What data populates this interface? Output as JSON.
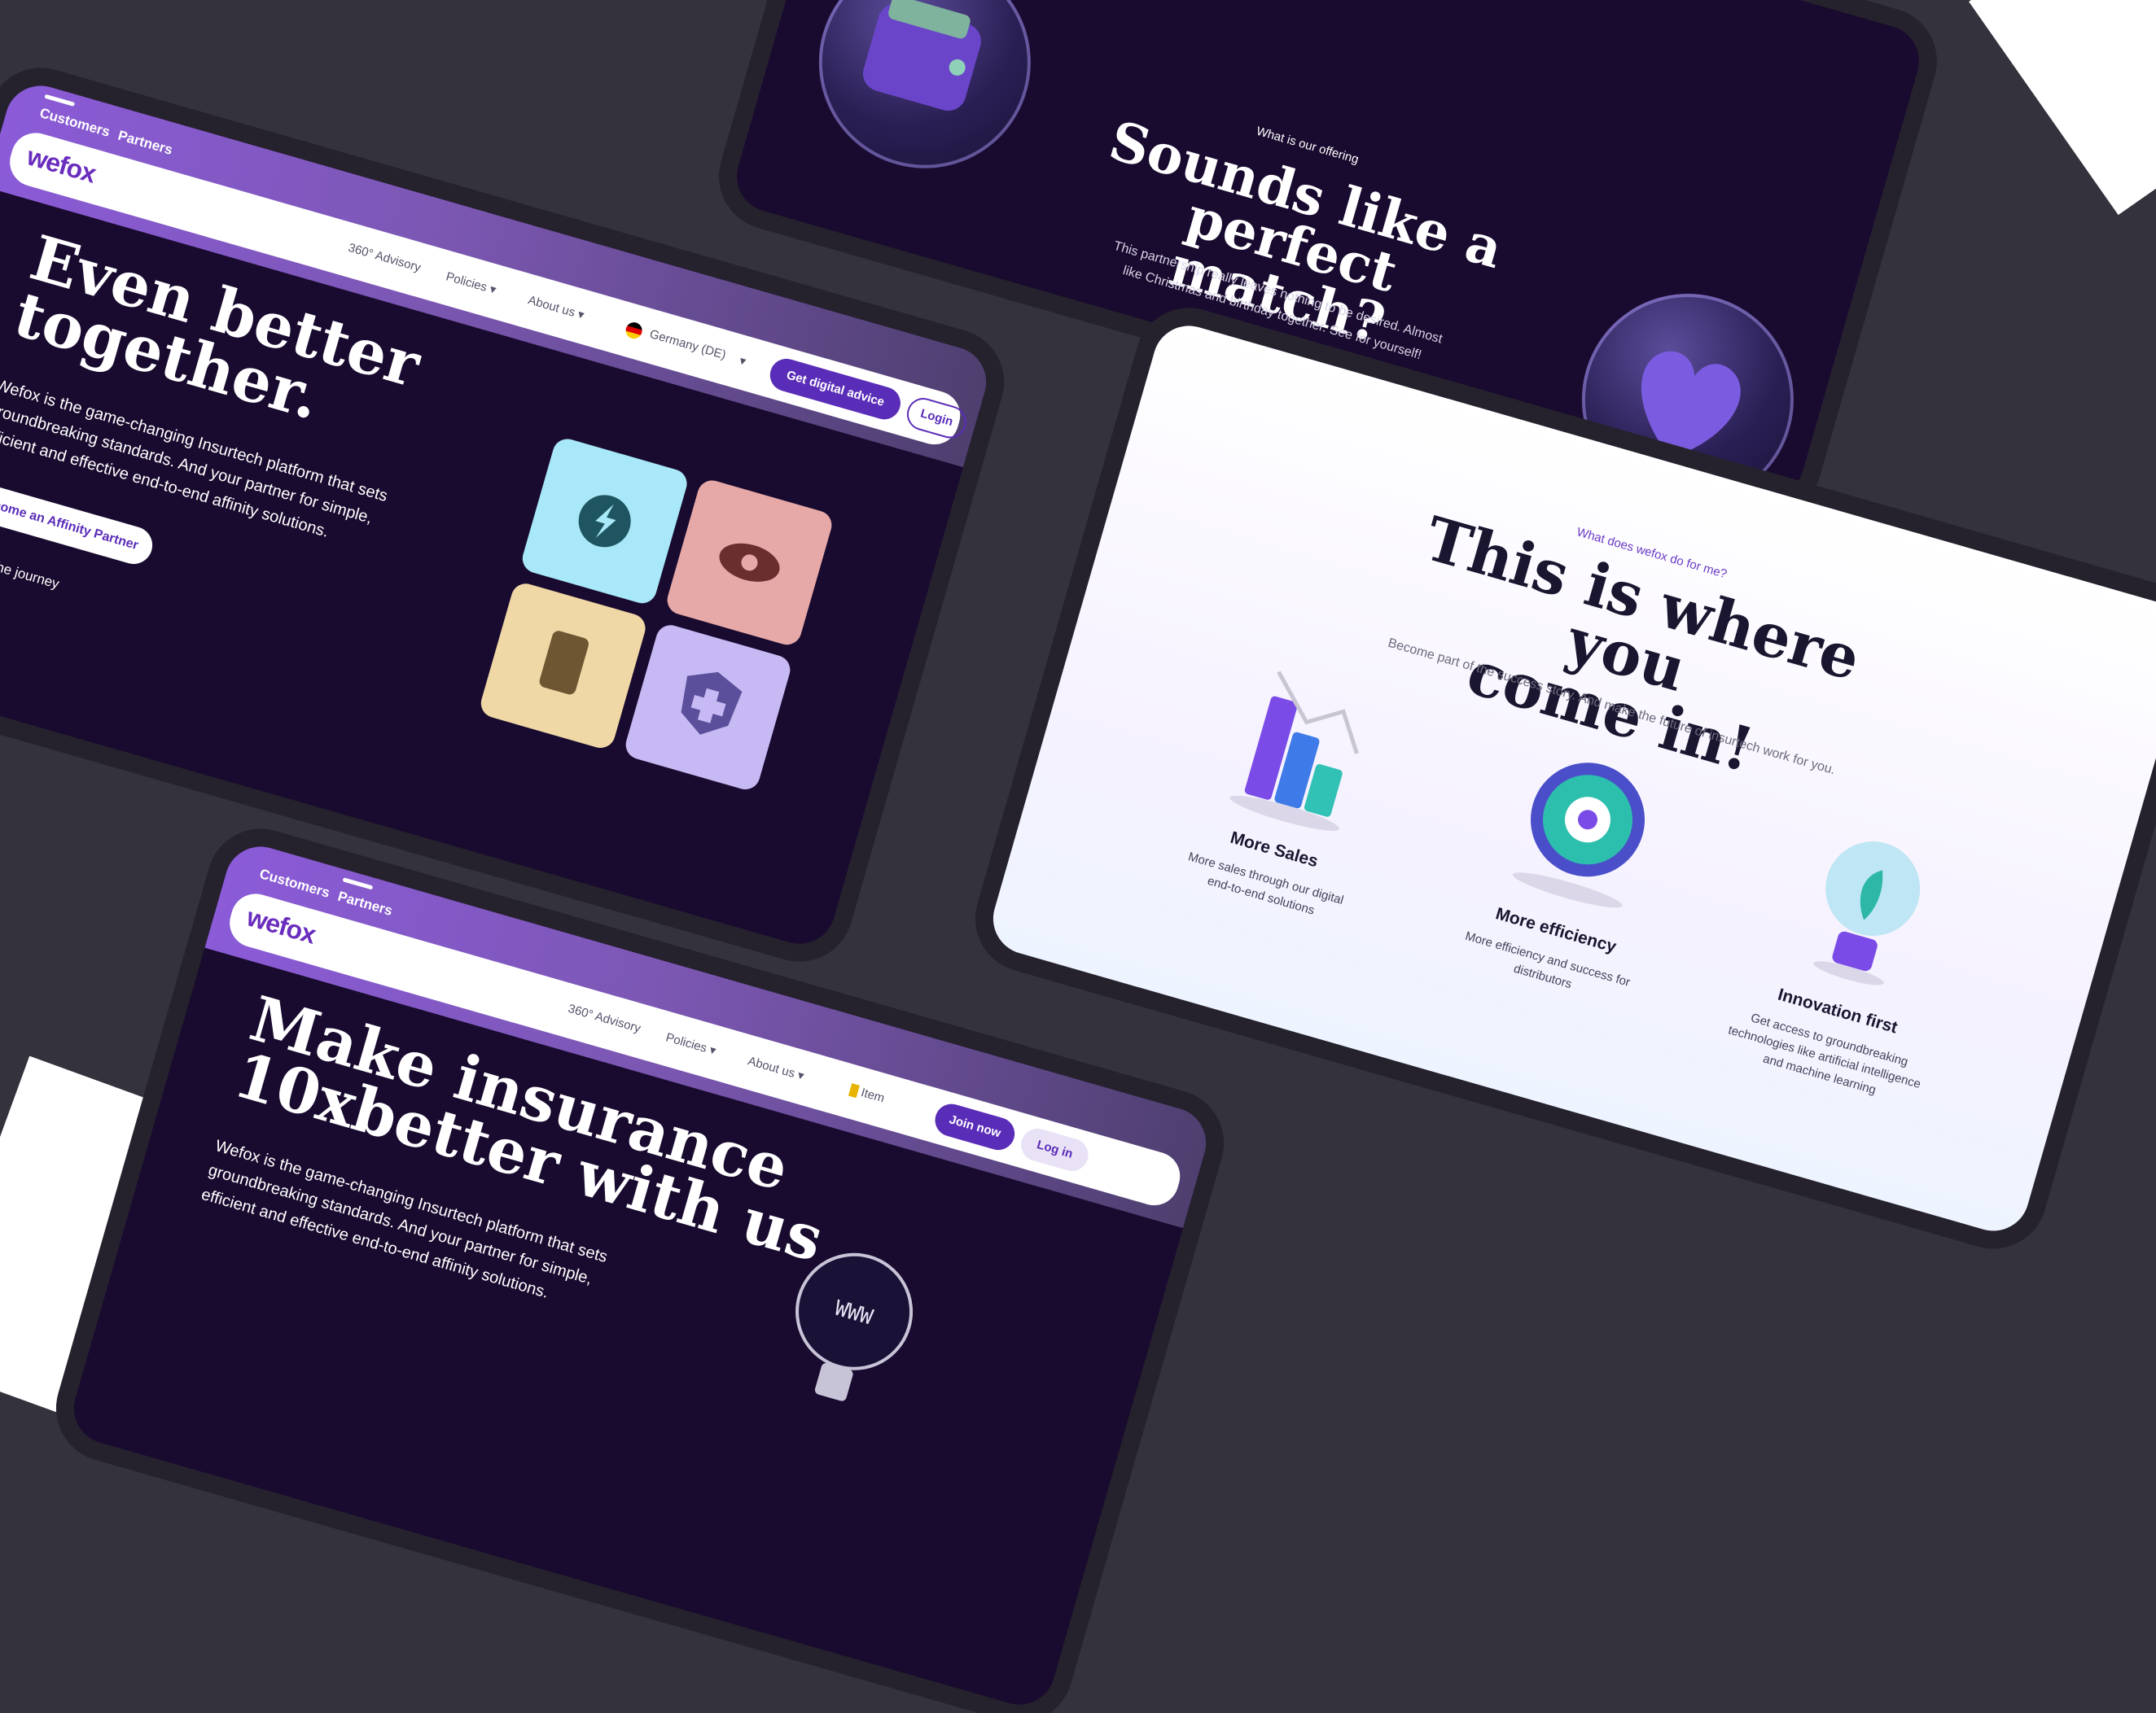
{
  "hero_site": {
    "tabs": [
      "Customers",
      "Partners"
    ],
    "logo": "wefox",
    "nav": [
      "360° Advisory",
      "Policies",
      "About us"
    ],
    "country": "Germany (DE)",
    "primary_button": "Get digital advice",
    "login_button": "Login",
    "title_line1": "Even better",
    "title_line2": "together.",
    "description": "Wefox is the game-changing Insurtech platform that sets groundbreaking standards. And your partner for simple, efficient and effective end-to-end affinity solutions.",
    "cta": "Become an Affinity Partner",
    "journey": "Start the journey"
  },
  "offering": {
    "eyebrow": "What is our offering",
    "title_line1": "Sounds like a perfect",
    "title_line2": "match?",
    "description": "This partnership really leaves nothing to be desired. Almost like Christmas and birthday together. See for yourself!"
  },
  "benefits": {
    "eyebrow": "What does wefox do for me?",
    "title_line1": "This is where you",
    "title_line2": "come in!",
    "description": "Become part of the success story. And make the future of insurtech work for you.",
    "features": [
      {
        "title": "More Sales",
        "desc": "More sales through our digital end-to-end solutions"
      },
      {
        "title": "More efficiency",
        "desc": "More efficiency and success for distributors"
      },
      {
        "title": "Innovation first",
        "desc": "Get access to groundbreaking technologies like artificial intelligence and machine learning"
      }
    ]
  },
  "second_site": {
    "tabs": [
      "Customers",
      "Partners"
    ],
    "logo": "wefox",
    "nav": [
      "360° Advisory",
      "Policies",
      "About us"
    ],
    "item_label": "Item",
    "join_button": "Join now",
    "login_button": "Log in",
    "title_line1": "Make insurance",
    "title_line2": "10xbetter with us",
    "description": "Wefox is the game-changing Insurtech platform that sets groundbreaking standards. And your partner for simple, efficient and effective end-to-end affinity solutions.",
    "bulb_text": "WWW"
  },
  "colors": {
    "background": "#34323d",
    "dark_page": "#190b2f",
    "accent": "#5a2db8",
    "gradient_start": "#8b5bd8"
  },
  "icons": [
    "lightning-icon",
    "eye-icon",
    "phone-icon",
    "shield-plus-icon",
    "chevron-down-icon",
    "pin-icon",
    "heart-icon",
    "wallet-icon",
    "bar-chart-icon",
    "gear-icon",
    "lightbulb-icon",
    "flag-icon"
  ]
}
